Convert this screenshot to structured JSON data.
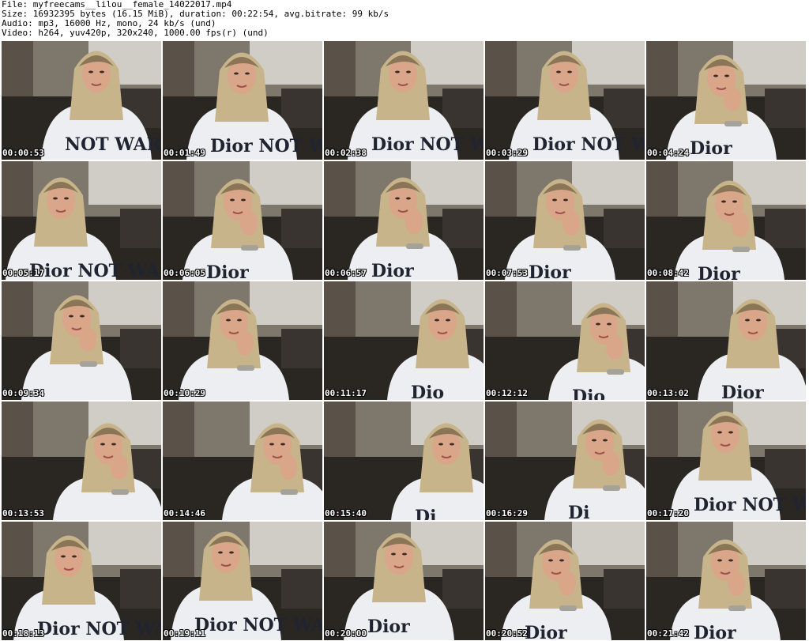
{
  "header": {
    "file_line": "File: myfreecams__lilou__female_14022017.mp4",
    "size_line": "Size: 16932395 bytes (16.15 MiB), duration: 00:22:54, avg.bitrate: 99 kb/s",
    "audio_line": "Audio: mp3, 16000 Hz, mono, 24 kb/s (und)",
    "video_line": "Video: h264, yuv420p, 320x240, 1000.00 fps(r) (und)"
  },
  "thumbnails": [
    {
      "timestamp": "00:00:53",
      "shirt_text": "NOT WAR"
    },
    {
      "timestamp": "00:01:49",
      "shirt_text": "Dior NOT WAR"
    },
    {
      "timestamp": "00:02:38",
      "shirt_text": "Dior NOT WAR"
    },
    {
      "timestamp": "00:03:29",
      "shirt_text": "Dior NOT WAR"
    },
    {
      "timestamp": "00:04:24",
      "shirt_text": "Dior"
    },
    {
      "timestamp": "00:05:17",
      "shirt_text": "Dior NOT WAR"
    },
    {
      "timestamp": "00:06:05",
      "shirt_text": "Dior"
    },
    {
      "timestamp": "00:06:57",
      "shirt_text": "Dior"
    },
    {
      "timestamp": "00:07:53",
      "shirt_text": "Dior"
    },
    {
      "timestamp": "00:08:42",
      "shirt_text": "Dior"
    },
    {
      "timestamp": "00:09:34",
      "shirt_text": ""
    },
    {
      "timestamp": "00:10:29",
      "shirt_text": ""
    },
    {
      "timestamp": "00:11:17",
      "shirt_text": "Dio"
    },
    {
      "timestamp": "00:12:12",
      "shirt_text": "Dio"
    },
    {
      "timestamp": "00:13:02",
      "shirt_text": "Dior"
    },
    {
      "timestamp": "00:13:53",
      "shirt_text": ""
    },
    {
      "timestamp": "00:14:46",
      "shirt_text": ""
    },
    {
      "timestamp": "00:15:40",
      "shirt_text": "Di"
    },
    {
      "timestamp": "00:16:29",
      "shirt_text": "Di"
    },
    {
      "timestamp": "00:17:20",
      "shirt_text": "Dior NOT WAR"
    },
    {
      "timestamp": "00:18:13",
      "shirt_text": "Dior NOT WAR"
    },
    {
      "timestamp": "00:19:11",
      "shirt_text": "Dior NOT WAR"
    },
    {
      "timestamp": "00:20:00",
      "shirt_text": "Dior"
    },
    {
      "timestamp": "00:20:52",
      "shirt_text": "Dior"
    },
    {
      "timestamp": "00:21:42",
      "shirt_text": "Dior"
    }
  ],
  "colors": {
    "background": "#ffffff",
    "timestamp_text": "#ffffff",
    "wall": "#7d776c",
    "cabinet": "#d8d6d0",
    "floor_dark": "#2a2622",
    "shirt": "#eceef2",
    "hair": "#c8b48a",
    "skin": "#d9a68a"
  }
}
